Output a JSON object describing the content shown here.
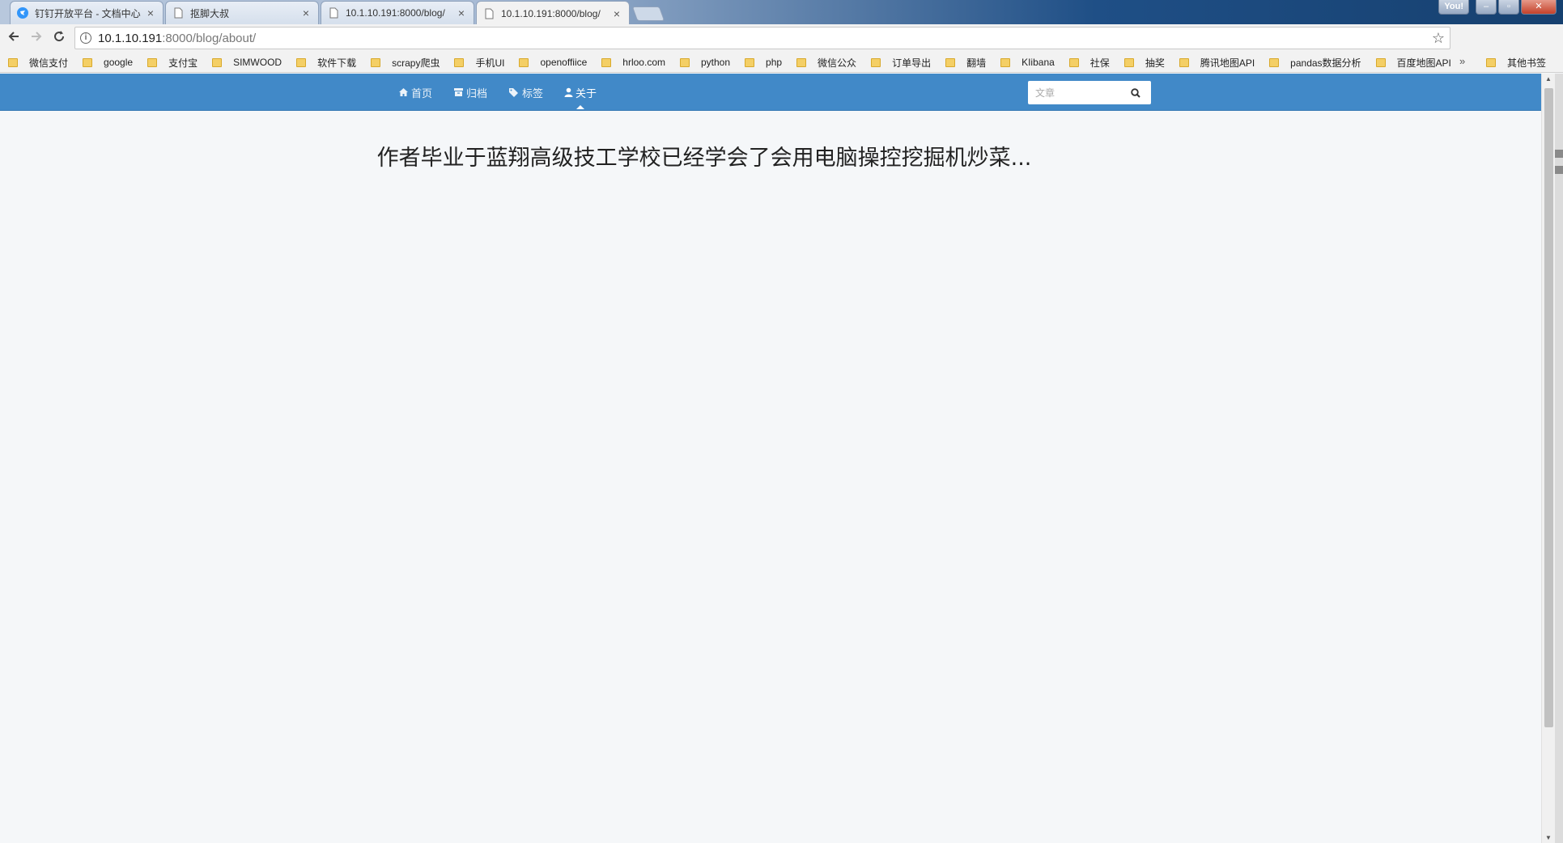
{
  "browser": {
    "tabs": [
      {
        "title": "钉钉开放平台 - 文档中心",
        "icon": "dingtalk-icon",
        "active": false
      },
      {
        "title": "抠脚大叔",
        "icon": "page-icon",
        "active": false
      },
      {
        "title": "10.1.10.191:8000/blog/",
        "icon": "page-icon",
        "active": false
      },
      {
        "title": "10.1.10.191:8000/blog/",
        "icon": "page-icon",
        "active": true
      }
    ],
    "profile_label": "You!",
    "url_host": "10.1.10.191",
    "url_path": ":8000/blog/about/",
    "bookmarks": [
      "微信支付",
      "google",
      "支付宝",
      "SIMWOOD",
      "软件下载",
      "scrapy爬虫",
      "手机UI",
      "openoffiice",
      "hrloo.com",
      "python",
      "php",
      "微信公众",
      "订单导出",
      "翻墙",
      "KIibana",
      "社保",
      "抽奖",
      "腾讯地图API",
      "pandas数据分析",
      "百度地图API"
    ],
    "bookmarks_more": "»",
    "other_bookmarks": "其他书签"
  },
  "site": {
    "nav": [
      {
        "label": "首页",
        "icon": "home-icon"
      },
      {
        "label": "归档",
        "icon": "archive-icon"
      },
      {
        "label": "标签",
        "icon": "tags-icon"
      },
      {
        "label": "关于",
        "icon": "user-icon",
        "active": true
      }
    ],
    "search_placeholder": "文章",
    "about_text": "作者毕业于蓝翔高级技工学校已经学会了会用电脑操控挖掘机炒菜..."
  },
  "colors": {
    "nav_bg": "#4189c8",
    "page_bg": "#f5f7f9"
  }
}
